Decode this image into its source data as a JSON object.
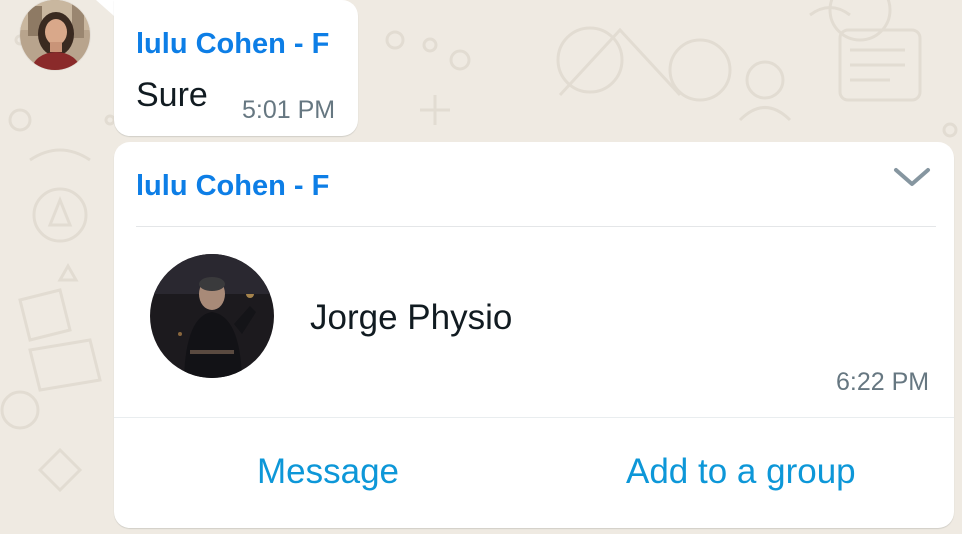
{
  "messages": [
    {
      "sender": "lulu Cohen - F",
      "text": "Sure",
      "time": "5:01 PM"
    }
  ],
  "contact_card": {
    "sender": "lulu Cohen - F",
    "contact_name": "Jorge Physio",
    "time": "6:22 PM",
    "actions": {
      "message_label": "Message",
      "add_to_group_label": "Add to a group"
    },
    "menu_icon": "chevron-down-icon"
  },
  "colors": {
    "chat_background": "#efeae2",
    "bubble": "#ffffff",
    "sender_name": "#0d7ee6",
    "action_link": "#0d97d8",
    "timestamp": "#667781"
  }
}
